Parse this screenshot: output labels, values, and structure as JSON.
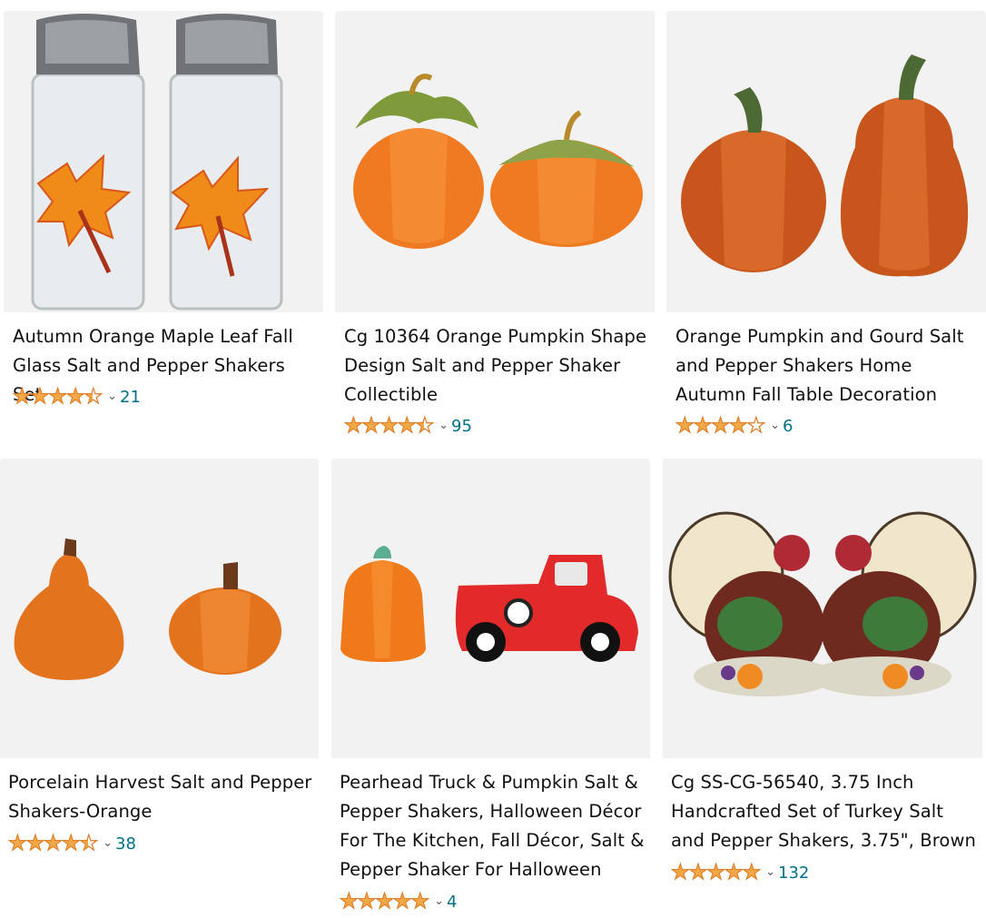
{
  "products": [
    {
      "title_line1": "Autumn Orange Maple Leaf Fall",
      "title_line2": "Glass Salt and Pepper Shakers Set",
      "title_line3": "",
      "title_line4": "",
      "rating": 4.5,
      "rating_count": "21",
      "chevron": "⌄",
      "image_icon": "maple-leaf-glass-shakers-image"
    },
    {
      "title_line1": "Cg 10364 Orange Pumpkin Shape",
      "title_line2": "Design Salt and Pepper Shaker",
      "title_line3": "Collectible",
      "title_line4": "",
      "rating": 4.5,
      "rating_count": "95",
      "chevron": "⌄",
      "image_icon": "orange-pumpkin-shakers-image"
    },
    {
      "title_line1": "Orange Pumpkin and Gourd Salt",
      "title_line2": "and Pepper Shakers Home",
      "title_line3": "Autumn Fall Table Decoration",
      "title_line4": "",
      "rating": 4.0,
      "rating_count": "6",
      "chevron": "⌄",
      "image_icon": "pumpkin-gourd-shakers-image"
    },
    {
      "title_line1": "Porcelain Harvest Salt and Pepper",
      "title_line2": "Shakers-Orange",
      "title_line3": "",
      "title_line4": "",
      "rating": 4.5,
      "rating_count": "38",
      "chevron": "⌄",
      "image_icon": "harvest-gourd-pumpkin-shakers-image"
    },
    {
      "title_line1": "Pearhead Truck & Pumpkin Salt &",
      "title_line2": "Pepper Shakers, Halloween Décor",
      "title_line3": "For The Kitchen, Fall Décor, Salt &",
      "title_line4": "Pepper Shaker For Halloween",
      "rating": 5.0,
      "rating_count": "4",
      "chevron": "⌄",
      "image_icon": "truck-pumpkin-shakers-image"
    },
    {
      "title_line1": "Cg SS-CG-56540, 3.75 Inch",
      "title_line2": "Handcrafted Set of Turkey Salt",
      "title_line3": "and Pepper Shakers, 3.75\", Brown",
      "title_line4": "",
      "rating": 5.0,
      "rating_count": "132",
      "chevron": "⌄",
      "image_icon": "turkey-shakers-image"
    }
  ],
  "colors": {
    "star": "#f3a847",
    "star_outline": "#de7921",
    "count_link": "#007185",
    "image_bg": "#f2f2f2",
    "text": "#0f1111"
  }
}
